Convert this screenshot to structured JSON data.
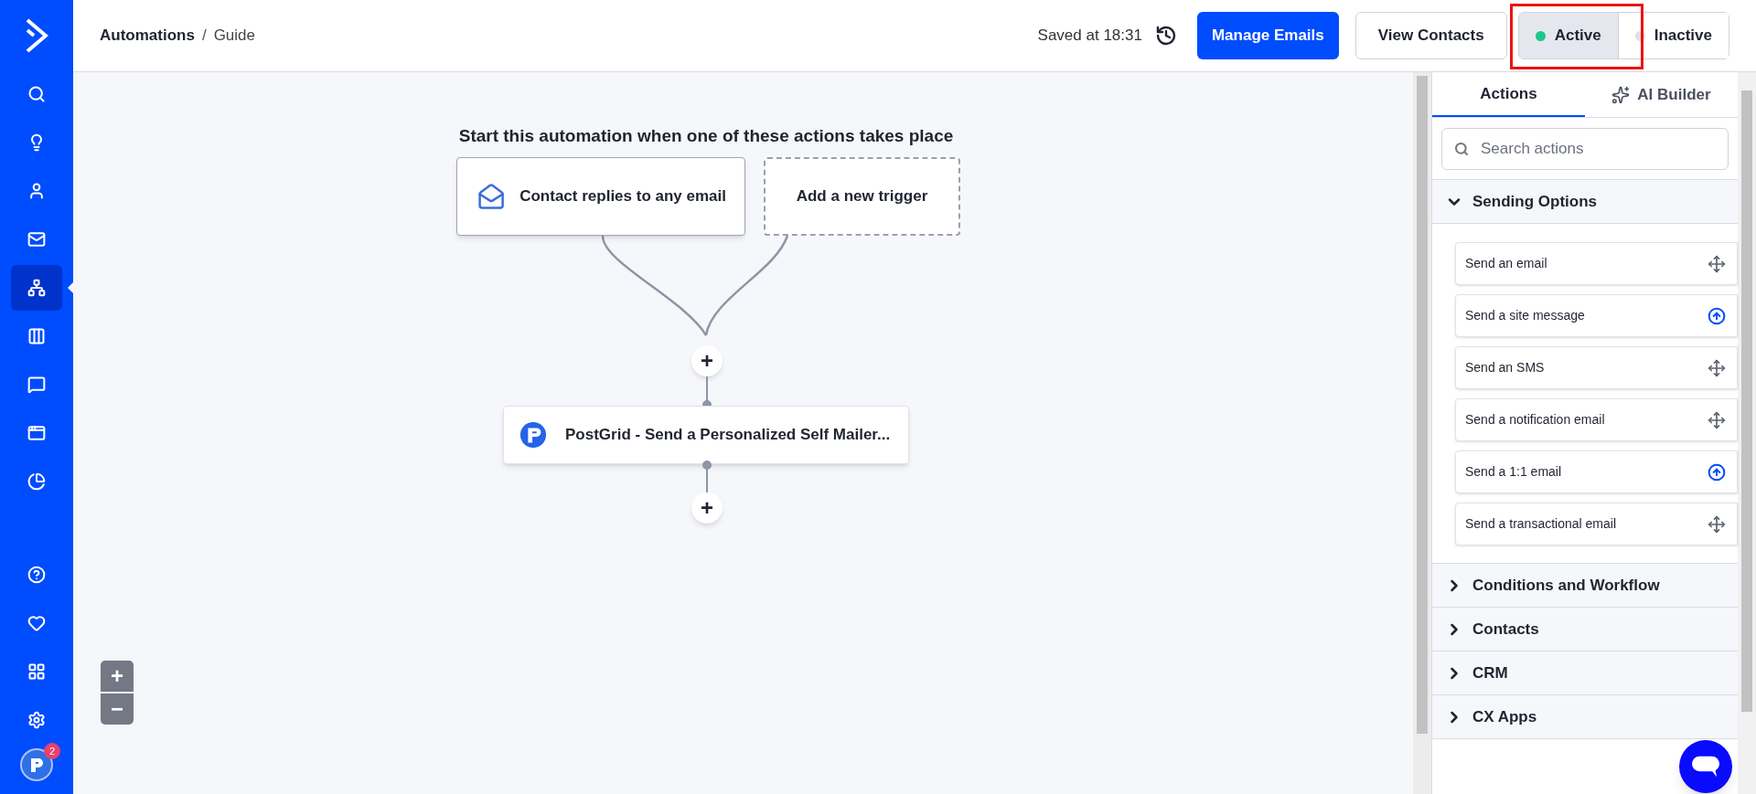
{
  "sidebar": {
    "items": [
      {
        "selected": false
      },
      {
        "selected": false
      },
      {
        "selected": false
      },
      {
        "selected": false
      },
      {
        "selected": true
      },
      {
        "selected": false
      },
      {
        "selected": false
      },
      {
        "selected": false
      },
      {
        "selected": false
      }
    ],
    "bottom_items": [
      {
        "selected": false
      },
      {
        "selected": false
      },
      {
        "selected": false
      },
      {
        "selected": false
      }
    ],
    "avatar_badge": "2"
  },
  "breadcrumb": {
    "root": "Automations",
    "separator": "/",
    "current": "Guide"
  },
  "header": {
    "saved": "Saved at 18:31",
    "manage_button": "Manage Emails",
    "view_button": "View Contacts",
    "status": [
      {
        "label": "Active",
        "selected": true,
        "color": "#1fc58d"
      },
      {
        "label": "Inactive",
        "selected": false,
        "color": "#dcdfe6"
      }
    ]
  },
  "canvas": {
    "title": "Start this automation when one of these actions takes place",
    "triggers": [
      {
        "label": "Contact replies to any email",
        "kind": "trigger"
      },
      {
        "label": "Add a new trigger",
        "kind": "placeholder"
      }
    ],
    "add_step": "+",
    "action": {
      "label": "PostGrid - Send a Personalized Self Mailer..."
    },
    "add_end": "+",
    "zoom_in": "+",
    "zoom_out": "−"
  },
  "panel": {
    "tabs": [
      {
        "label": "Actions",
        "selected": true
      },
      {
        "label": "AI Builder",
        "selected": false
      }
    ],
    "search": {
      "placeholder": "Search actions"
    },
    "groups": [
      {
        "label": "Sending Options",
        "expanded": true,
        "items": [
          {
            "label": "Send an email",
            "kind": "drag"
          },
          {
            "label": "Send a site message",
            "kind": "upgrade"
          },
          {
            "label": "Send an SMS",
            "kind": "drag"
          },
          {
            "label": "Send a notification email",
            "kind": "drag"
          },
          {
            "label": "Send a 1:1 email",
            "kind": "upgrade"
          },
          {
            "label": "Send a transactional email",
            "kind": "drag"
          }
        ]
      },
      {
        "label": "Conditions and Workflow",
        "expanded": false
      },
      {
        "label": "Contacts",
        "expanded": false
      },
      {
        "label": "CRM",
        "expanded": false
      },
      {
        "label": "CX Apps",
        "expanded": false
      }
    ]
  }
}
